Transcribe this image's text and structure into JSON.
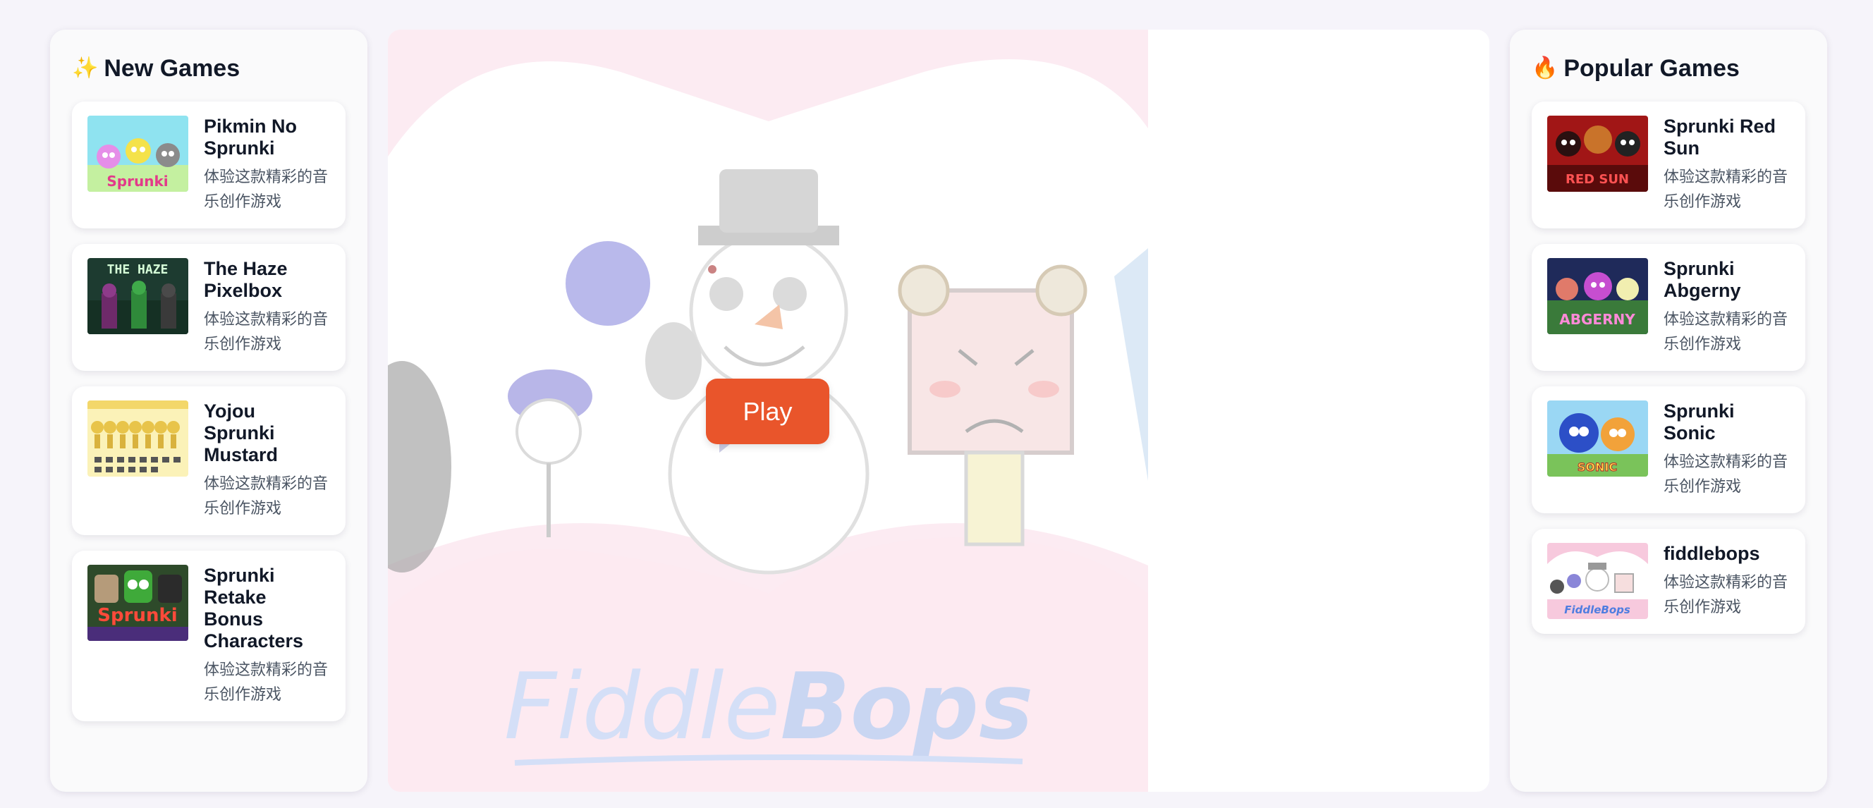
{
  "new_games": {
    "icon": "sparkles-icon",
    "icon_glyph": "✨",
    "title": "New Games",
    "items": [
      {
        "title": "Pikmin No Sprunki",
        "desc": "体验这款精彩的音乐创作游戏",
        "thumb_text": "Sprunki"
      },
      {
        "title": "The Haze Pixelbox",
        "desc": "体验这款精彩的音乐创作游戏",
        "thumb_text": "THE HAZE"
      },
      {
        "title": "Yojou Sprunki Mustard",
        "desc": "体验这款精彩的音乐创作游戏",
        "thumb_text": ""
      },
      {
        "title": "Sprunki Retake Bonus Characters",
        "desc": "体验这款精彩的音乐创作游戏",
        "thumb_text": "Sprunki"
      }
    ]
  },
  "popular_games": {
    "icon": "fire-icon",
    "icon_glyph": "🔥",
    "title": "Popular Games",
    "items": [
      {
        "title": "Sprunki Red Sun",
        "desc": "体验这款精彩的音乐创作游戏",
        "thumb_text": "RED SUN"
      },
      {
        "title": "Sprunki Abgerny",
        "desc": "体验这款精彩的音乐创作游戏",
        "thumb_text": "ABGERNY"
      },
      {
        "title": "Sprunki Sonic",
        "desc": "体验这款精彩的音乐创作游戏",
        "thumb_text": "SONIC"
      },
      {
        "title": "fiddlebops",
        "desc": "体验这款精彩的音乐创作游戏",
        "thumb_text": "FiddleBops"
      }
    ]
  },
  "game": {
    "logo_text_light": "Fiddle",
    "logo_text_bold": "Bops",
    "play_label": "Play"
  },
  "colors": {
    "accent": "#e9552b",
    "page_bg": "#f6f4fa",
    "card_bg": "#ffffff",
    "stage_pink": "#fbe4ee"
  }
}
